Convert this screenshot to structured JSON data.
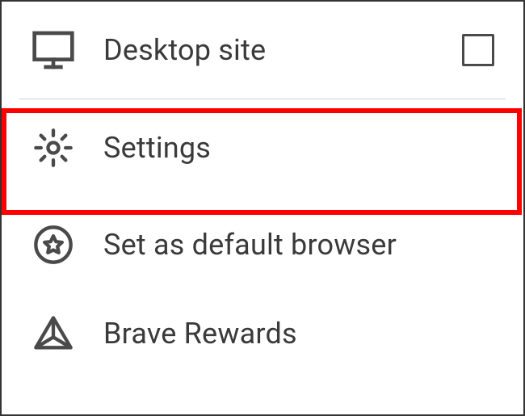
{
  "menu": {
    "items": [
      {
        "icon": "monitor-icon",
        "label": "Desktop site",
        "checkbox": true
      },
      {
        "icon": "gear-icon",
        "label": "Settings",
        "checkbox": false,
        "highlighted": true
      },
      {
        "icon": "star-icon",
        "label": "Set as default browser",
        "checkbox": false
      },
      {
        "icon": "triangle-icon",
        "label": "Brave Rewards",
        "checkbox": false
      }
    ]
  },
  "annotation": {
    "highlight_color": "#ff0000"
  }
}
